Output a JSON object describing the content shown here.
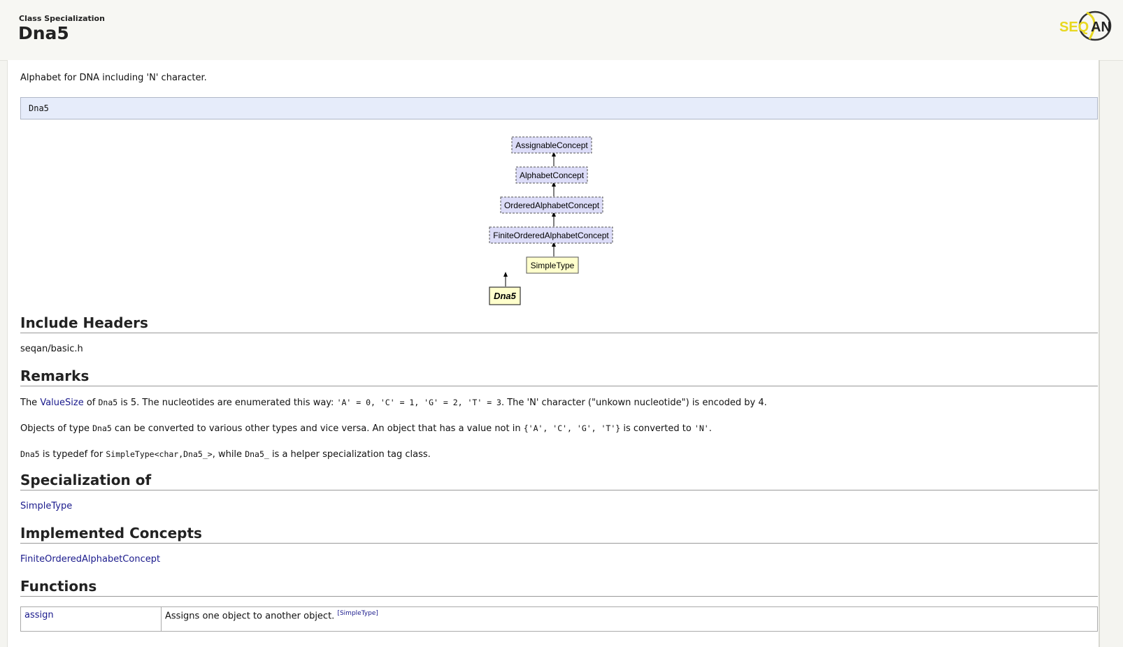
{
  "header": {
    "kind": "Class Specialization",
    "title": "Dna5",
    "logo_text": "SEQAN",
    "colors": {
      "logo_yellow": "#e8d820",
      "logo_dark": "#222222"
    }
  },
  "abstract": "Alphabet for DNA including 'N' character.",
  "signature": "Dna5",
  "diagram": {
    "nodes": [
      {
        "label": "AssignableConcept",
        "kind": "concept"
      },
      {
        "label": "AlphabetConcept",
        "kind": "concept"
      },
      {
        "label": "OrderedAlphabetConcept",
        "kind": "concept"
      },
      {
        "label": "FiniteOrderedAlphabetConcept",
        "kind": "concept"
      },
      {
        "label": "SimpleType",
        "kind": "class"
      },
      {
        "label": "Dna5",
        "kind": "current"
      }
    ],
    "colors": {
      "concept_fill": "#dcdcf8",
      "class_fill": "#ffffcc",
      "current_fill": "#ffffcc"
    }
  },
  "sections": {
    "include_headers": {
      "title": "Include Headers",
      "value": "seqan/basic.h"
    },
    "remarks": {
      "title": "Remarks",
      "p1": {
        "t1": "The ",
        "link": "ValueSize",
        "t2": " of ",
        "c1": "Dna5",
        "t3": " is 5. The nucleotides are enumerated this way: ",
        "c2": "'A' = 0, 'C' = 1, 'G' = 2, 'T' = 3",
        "t4": ". The 'N' character (\"unkown nucleotide\") is encoded by 4."
      },
      "p2": {
        "t1": "Objects of type ",
        "c1": "Dna5",
        "t2": " can be converted to various other types and vice versa. An object that has a value not in ",
        "c2": "{'A', 'C', 'G', 'T'}",
        "t3": " is converted to ",
        "c3": "'N'",
        "t4": "."
      },
      "p3": {
        "c1": "Dna5",
        "t1": " is typedef for ",
        "c2": "SimpleType<char,Dna5_>",
        "t2": ", while ",
        "c3": "Dna5_",
        "t3": " is a helper specialization tag class."
      }
    },
    "specialization_of": {
      "title": "Specialization of",
      "link": "SimpleType"
    },
    "implemented_concepts": {
      "title": "Implemented Concepts",
      "link": "FiniteOrderedAlphabetConcept"
    },
    "functions": {
      "title": "Functions",
      "rows": [
        {
          "name": "assign",
          "desc": "Assigns one object to another object.",
          "source": "[SimpleType]"
        }
      ]
    }
  }
}
